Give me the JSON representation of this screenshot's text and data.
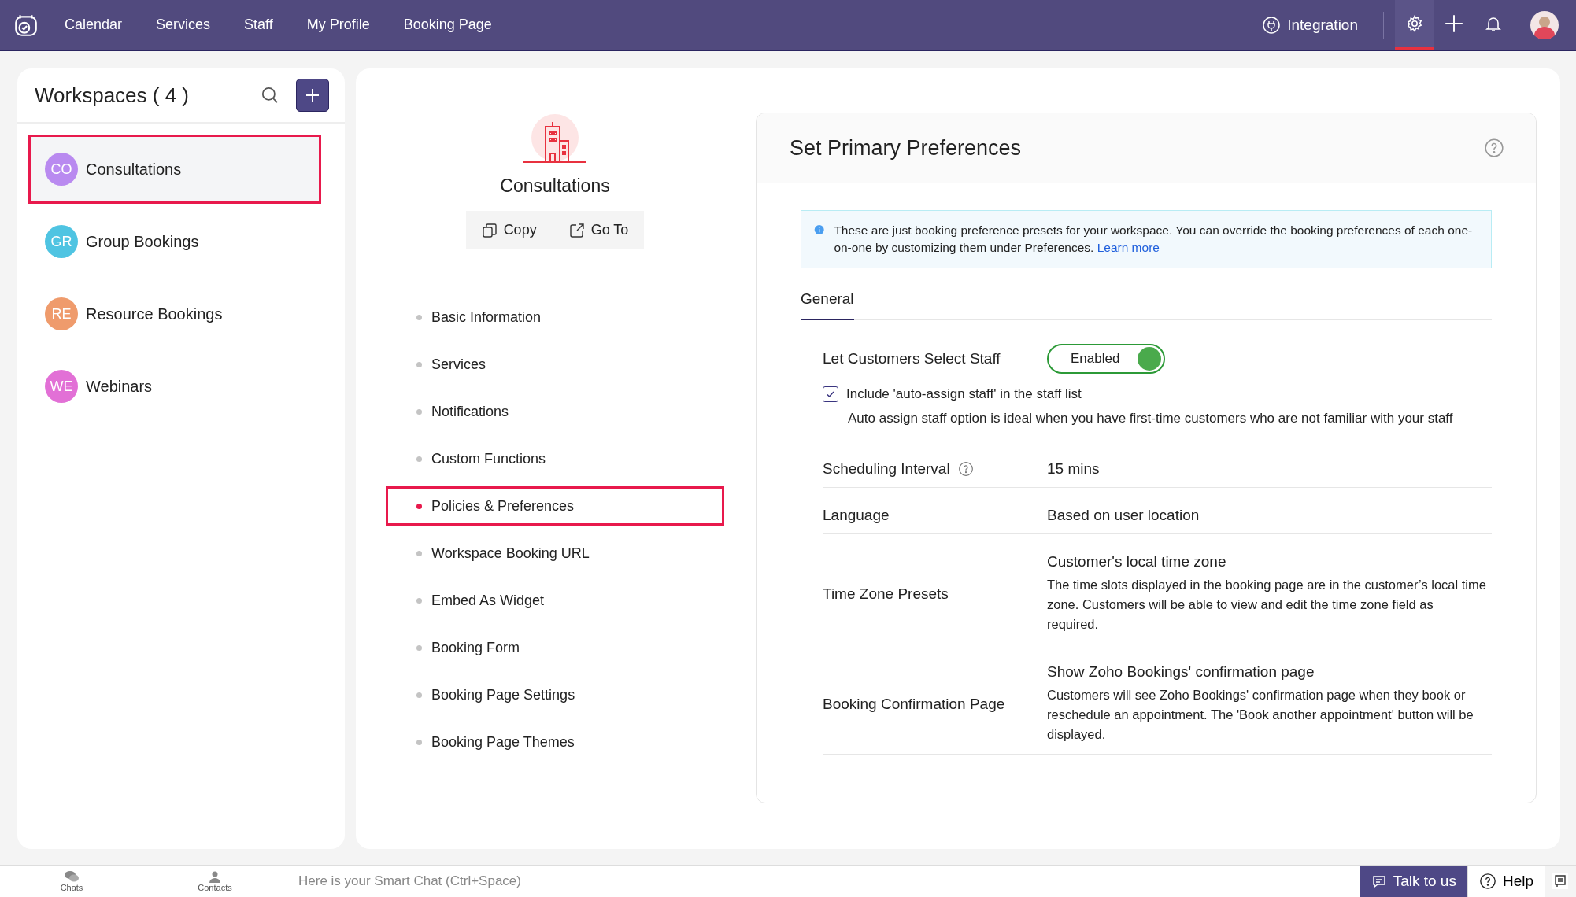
{
  "topbar": {
    "nav": [
      {
        "label": "Calendar"
      },
      {
        "label": "Services"
      },
      {
        "label": "Staff"
      },
      {
        "label": "My Profile"
      },
      {
        "label": "Booking Page"
      }
    ],
    "integration": "Integration",
    "tools": [
      {
        "kind": "settings",
        "selected": true
      },
      {
        "kind": "add",
        "selected": false
      },
      {
        "kind": "notifications",
        "selected": false
      }
    ]
  },
  "workspaces": {
    "title": "Workspaces ( 4 )",
    "items": [
      {
        "initials": "CO",
        "name": "Consultations",
        "color": "#b98af0",
        "selected": true
      },
      {
        "initials": "GR",
        "name": "Group Bookings",
        "color": "#4fc4e2",
        "selected": false
      },
      {
        "initials": "RE",
        "name": "Resource Bookings",
        "color": "#ef9b6c",
        "selected": false
      },
      {
        "initials": "WE",
        "name": "Webinars",
        "color": "#e270d6",
        "selected": false
      }
    ]
  },
  "workspace": {
    "name": "Consultations",
    "actions": [
      {
        "kind": "copy",
        "label": "Copy"
      },
      {
        "kind": "goto",
        "label": "Go To"
      }
    ],
    "menu": [
      {
        "label": "Basic Information",
        "selected": false
      },
      {
        "label": "Services",
        "selected": false
      },
      {
        "label": "Notifications",
        "selected": false
      },
      {
        "label": "Custom Functions",
        "selected": false
      },
      {
        "label": "Policies & Preferences",
        "selected": true
      },
      {
        "label": "Workspace Booking URL",
        "selected": false
      },
      {
        "label": "Embed As Widget",
        "selected": false
      },
      {
        "label": "Booking Form",
        "selected": false
      },
      {
        "label": "Booking Page Settings",
        "selected": false
      },
      {
        "label": "Booking Page Themes",
        "selected": false
      }
    ]
  },
  "preferences": {
    "title": "Set Primary Preferences",
    "info": {
      "text": "These are just booking preference presets for your workspace. You can override the booking preferences of each one-on-one by customizing them under Preferences.",
      "link": "Learn more"
    },
    "tabs": [
      {
        "label": "General",
        "selected": true
      }
    ],
    "staff_select": {
      "label": "Let Customers Select Staff",
      "toggle": {
        "label": "Enabled",
        "on": true
      },
      "checkbox": {
        "label": "Include 'auto-assign staff' in the staff list",
        "checked": true
      },
      "hint": "Auto assign staff option is ideal when you have first-time customers who are not familiar with your staff"
    },
    "rows": [
      {
        "label": "Scheduling Interval",
        "help": true,
        "value": "15 mins"
      },
      {
        "label": "Language",
        "help": false,
        "value": "Based on user location"
      },
      {
        "label": "Time Zone Presets",
        "help": false,
        "value": "Customer's local time zone",
        "description": "The time slots displayed in the booking page are in the customer’s local time zone. Customers will be able to view and edit the time zone field as required."
      },
      {
        "label": "Booking Confirmation Page",
        "help": false,
        "value": "Show Zoho Bookings' confirmation page",
        "description": "Customers will see Zoho Bookings' confirmation page when they book or reschedule an appointment. The 'Book another appointment' button will be displayed."
      }
    ]
  },
  "footer": {
    "chats": "Chats",
    "contacts": "Contacts",
    "chat_placeholder": "Here is your Smart Chat (Ctrl+Space)",
    "talk": "Talk to us",
    "help": "Help"
  }
}
